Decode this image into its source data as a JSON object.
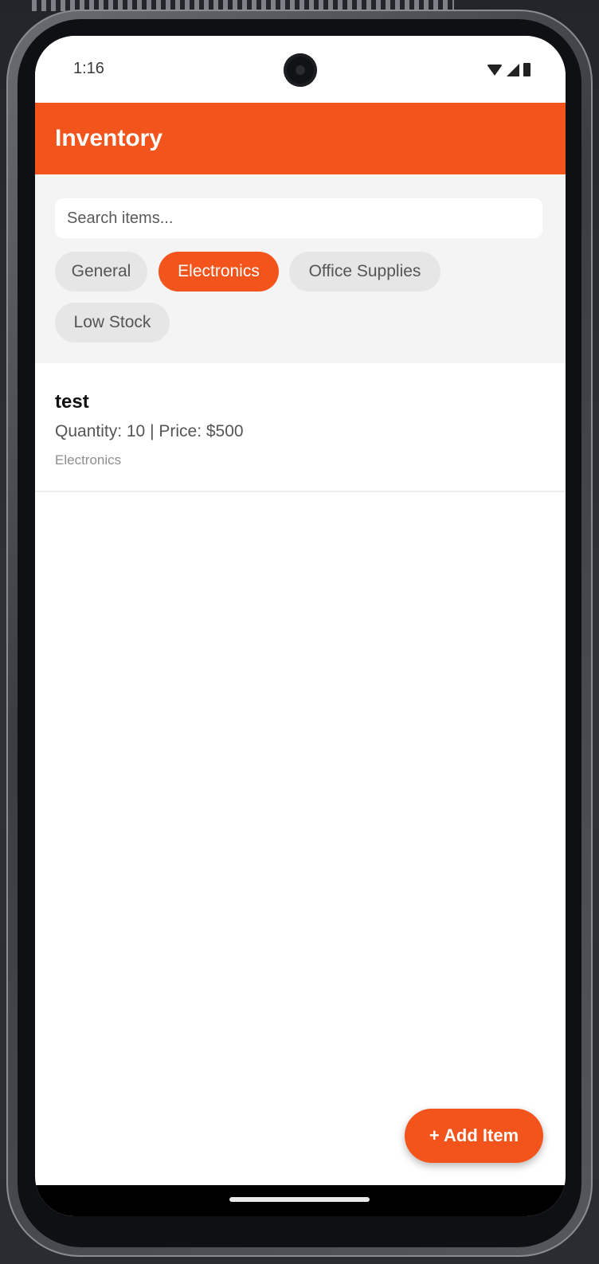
{
  "status_bar": {
    "time": "1:16",
    "icons": [
      "wifi-icon",
      "signal-icon",
      "battery-icon"
    ]
  },
  "app_bar": {
    "title": "Inventory"
  },
  "search": {
    "placeholder": "Search items...",
    "value": ""
  },
  "filters": {
    "chips": [
      {
        "label": "General",
        "active": false
      },
      {
        "label": "Electronics",
        "active": true
      },
      {
        "label": "Office Supplies",
        "active": false
      },
      {
        "label": "Low Stock",
        "active": false
      }
    ]
  },
  "items": [
    {
      "name": "test",
      "details": "Quantity: 10 | Price: $500",
      "category": "Electronics"
    }
  ],
  "fab": {
    "label": "+ Add Item"
  },
  "colors": {
    "accent": "#f2541b",
    "chip_inactive": "#e6e6e6",
    "filter_bg": "#f4f4f4"
  }
}
